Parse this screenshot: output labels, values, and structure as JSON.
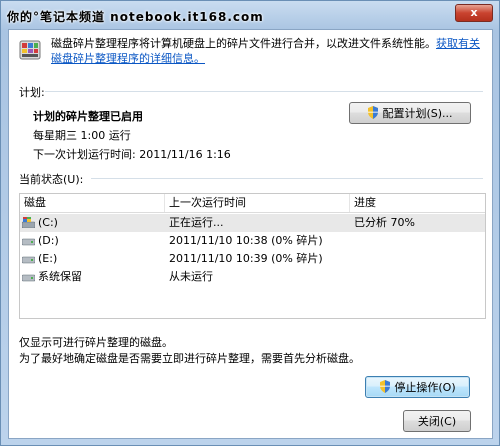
{
  "window": {
    "title": "你的°笔记本频道 notebook.it168.com",
    "close_label": "x"
  },
  "header": {
    "description": "磁盘碎片整理程序将计算机硬盘上的碎片文件进行合并，以改进文件系统性能。",
    "link": "获取有关磁盘碎片整理程序的详细信息。"
  },
  "schedule": {
    "section_label": "计划:",
    "status": "计划的碎片整理已启用",
    "frequency": "每星期三  1:00 运行",
    "next_run": "下一次计划运行时间: 2011/11/16 1:16",
    "configure_button": "配置计划(S)..."
  },
  "current_status": {
    "section_label": "当前状态(U):",
    "columns": [
      "磁盘",
      "上一次运行时间",
      "进度"
    ],
    "rows": [
      {
        "disk": "(C:)",
        "last_run": "正在运行...",
        "progress": "已分析 70%",
        "icon": "system-drive-icon"
      },
      {
        "disk": "(D:)",
        "last_run": "2011/11/10 10:38 (0% 碎片)",
        "progress": "",
        "icon": "drive-icon"
      },
      {
        "disk": "(E:)",
        "last_run": "2011/11/10 10:39 (0% 碎片)",
        "progress": "",
        "icon": "drive-icon"
      },
      {
        "disk": "系统保留",
        "last_run": "从未运行",
        "progress": "",
        "icon": "drive-icon"
      }
    ]
  },
  "notes": {
    "line1": "仅显示可进行碎片整理的磁盘。",
    "line2": "为了最好地确定磁盘是否需要立即进行碎片整理，需要首先分析磁盘。"
  },
  "actions": {
    "stop_button": "停止操作(O)",
    "close_button": "关闭(C)"
  },
  "colors": {
    "link": "#0b57c4",
    "selected_row": "#e8e8e8"
  }
}
